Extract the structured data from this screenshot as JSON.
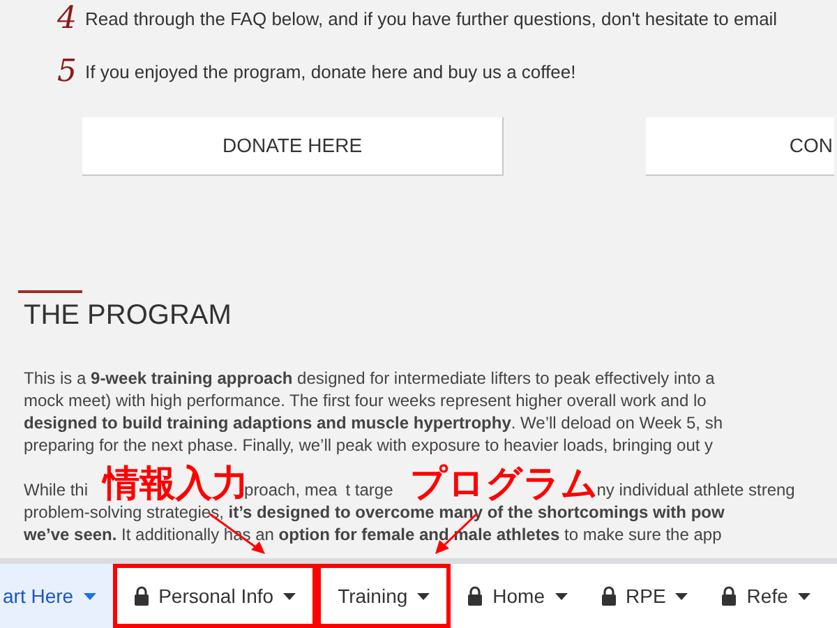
{
  "steps": [
    {
      "number": "4",
      "text": "Read through the FAQ below, and if you have further questions, don't hesitate to email"
    },
    {
      "number": "5",
      "text": "If you enjoyed the program, donate here and buy us a coffee!"
    }
  ],
  "buttons": [
    "DONATE HERE",
    "CON"
  ],
  "section": {
    "title": "THE PROGRAM",
    "paragraph_1": [
      "This is a **9-week training approach** designed for intermediate lifters to peak effectively into a",
      "mock meet) with high performance. The first four weeks represent higher overall work and lo",
      "**designed to build training adaptions and muscle hypertrophy**. We’ll deload on Week 5, sh",
      "preparing for the next phase. Finally, we’ll peak with exposure to heavier loads, bringing out y"
    ],
    "paragraph_2_first_line_fragments": [
      "While thi",
      "proach, mea",
      "t targe",
      "ny individual athlete streng"
    ],
    "paragraph_2": [
      "problem-solving strategies, **it’s designed to overcome many of the shortcomings with pow**",
      "**we’ve seen.** It additionally has an **option for female and male athletes** to make sure the app"
    ]
  },
  "nav_tabs": [
    {
      "label": "art Here",
      "locked": false,
      "selected": true,
      "boxed": false
    },
    {
      "label": "Personal Info",
      "locked": true,
      "selected": false,
      "boxed": true
    },
    {
      "label": "Training",
      "locked": false,
      "selected": false,
      "boxed": true
    },
    {
      "label": "Home",
      "locked": true,
      "selected": false,
      "boxed": false
    },
    {
      "label": "RPE",
      "locked": true,
      "selected": false,
      "boxed": false
    },
    {
      "label": "Refe",
      "locked": true,
      "selected": false,
      "boxed": false
    }
  ],
  "annotations": [
    "情報入力",
    "プログラム"
  ]
}
